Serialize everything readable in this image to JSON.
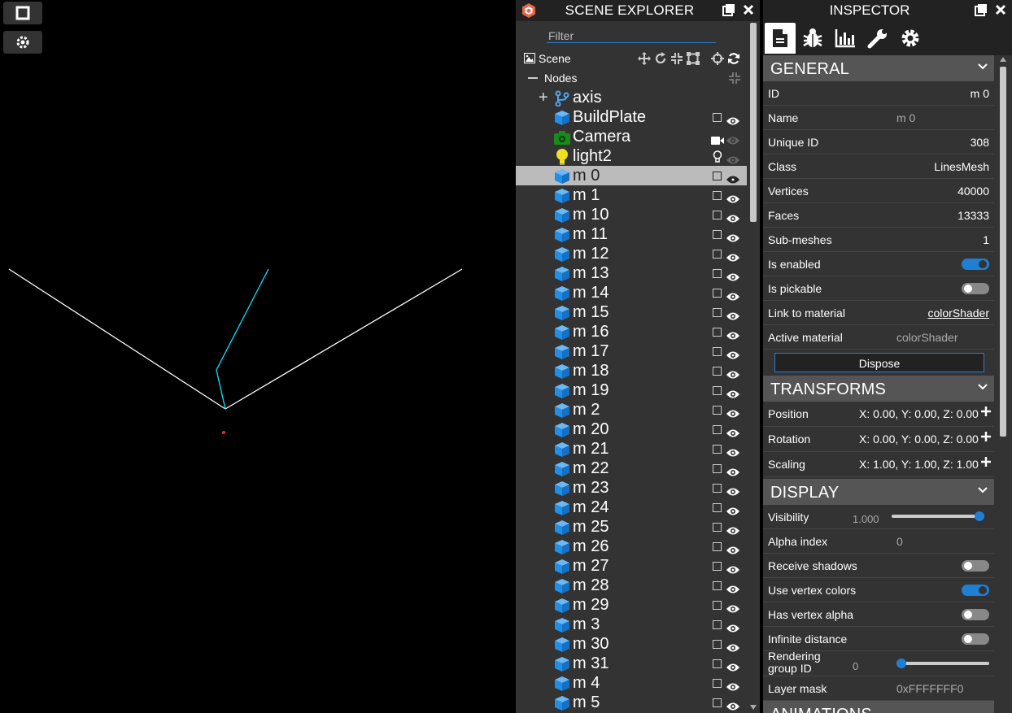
{
  "viewport": {
    "line_colors": {
      "axis": "#ffffff",
      "path": "#00ffff"
    },
    "buttons": [
      "square-icon",
      "gear-icon"
    ]
  },
  "scene_explorer": {
    "title": "SCENE EXPLORER",
    "filter_placeholder": "Filter",
    "scene_label": "Scene",
    "nodes_label": "Nodes",
    "items": [
      {
        "label": "axis",
        "icon": "bone-icon",
        "expandable": true
      },
      {
        "label": "BuildPlate",
        "icon": "cube-icon"
      },
      {
        "label": "Camera",
        "icon": "camera-icon"
      },
      {
        "label": "light2",
        "icon": "lightbulb-icon"
      },
      {
        "label": "m 0",
        "icon": "cube-icon",
        "selected": true
      },
      {
        "label": "m 1",
        "icon": "cube-icon"
      },
      {
        "label": "m 10",
        "icon": "cube-icon"
      },
      {
        "label": "m 11",
        "icon": "cube-icon"
      },
      {
        "label": "m 12",
        "icon": "cube-icon"
      },
      {
        "label": "m 13",
        "icon": "cube-icon"
      },
      {
        "label": "m 14",
        "icon": "cube-icon"
      },
      {
        "label": "m 15",
        "icon": "cube-icon"
      },
      {
        "label": "m 16",
        "icon": "cube-icon"
      },
      {
        "label": "m 17",
        "icon": "cube-icon"
      },
      {
        "label": "m 18",
        "icon": "cube-icon"
      },
      {
        "label": "m 19",
        "icon": "cube-icon"
      },
      {
        "label": "m 2",
        "icon": "cube-icon"
      },
      {
        "label": "m 20",
        "icon": "cube-icon"
      },
      {
        "label": "m 21",
        "icon": "cube-icon"
      },
      {
        "label": "m 22",
        "icon": "cube-icon"
      },
      {
        "label": "m 23",
        "icon": "cube-icon"
      },
      {
        "label": "m 24",
        "icon": "cube-icon"
      },
      {
        "label": "m 25",
        "icon": "cube-icon"
      },
      {
        "label": "m 26",
        "icon": "cube-icon"
      },
      {
        "label": "m 27",
        "icon": "cube-icon"
      },
      {
        "label": "m 28",
        "icon": "cube-icon"
      },
      {
        "label": "m 29",
        "icon": "cube-icon"
      },
      {
        "label": "m 3",
        "icon": "cube-icon"
      },
      {
        "label": "m 30",
        "icon": "cube-icon"
      },
      {
        "label": "m 31",
        "icon": "cube-icon"
      },
      {
        "label": "m 4",
        "icon": "cube-icon"
      },
      {
        "label": "m 5",
        "icon": "cube-icon"
      }
    ]
  },
  "inspector": {
    "title": "INSPECTOR",
    "tabs": [
      "document-icon",
      "bug-icon",
      "chart-icon",
      "wrench-icon",
      "gear-icon"
    ],
    "general": {
      "title": "GENERAL",
      "id_label": "ID",
      "id_value": "m 0",
      "name_label": "Name",
      "name_value": "m 0",
      "unique_id_label": "Unique ID",
      "unique_id_value": "308",
      "class_label": "Class",
      "class_value": "LinesMesh",
      "vertices_label": "Vertices",
      "vertices_value": "40000",
      "faces_label": "Faces",
      "faces_value": "13333",
      "submeshes_label": "Sub-meshes",
      "submeshes_value": "1",
      "enabled_label": "Is enabled",
      "enabled": true,
      "pickable_label": "Is pickable",
      "pickable": false,
      "link_material_label": "Link to material",
      "link_material_value": "colorShader",
      "active_material_label": "Active material",
      "active_material_value": "colorShader",
      "dispose_label": "Dispose"
    },
    "transforms": {
      "title": "TRANSFORMS",
      "position_label": "Position",
      "position_value": "X: 0.00, Y: 0.00, Z: 0.00",
      "rotation_label": "Rotation",
      "rotation_value": "X: 0.00, Y: 0.00, Z: 0.00",
      "scaling_label": "Scaling",
      "scaling_value": "X: 1.00, Y: 1.00, Z: 1.00"
    },
    "display": {
      "title": "DISPLAY",
      "visibility_label": "Visibility",
      "visibility_value": "1.000",
      "visibility_level": 1.0,
      "alpha_index_label": "Alpha index",
      "alpha_index_value": "0",
      "receive_shadows_label": "Receive shadows",
      "receive_shadows": false,
      "vertex_colors_label": "Use vertex colors",
      "vertex_colors": true,
      "vertex_alpha_label": "Has vertex alpha",
      "vertex_alpha": false,
      "infinite_distance_label": "Infinite distance",
      "infinite_distance": false,
      "rendering_group_label": "Rendering group ID",
      "rendering_group_value": "0",
      "rendering_group_level": 0.0,
      "layer_mask_label": "Layer mask",
      "layer_mask_value": "0xFFFFFFF0"
    },
    "animations_title": "ANIMATIONS"
  },
  "colors": {
    "accent": "#1f7fd3",
    "cube": "#1f8fe8",
    "camera": "#1a8a1a",
    "light": "#f0e020"
  }
}
